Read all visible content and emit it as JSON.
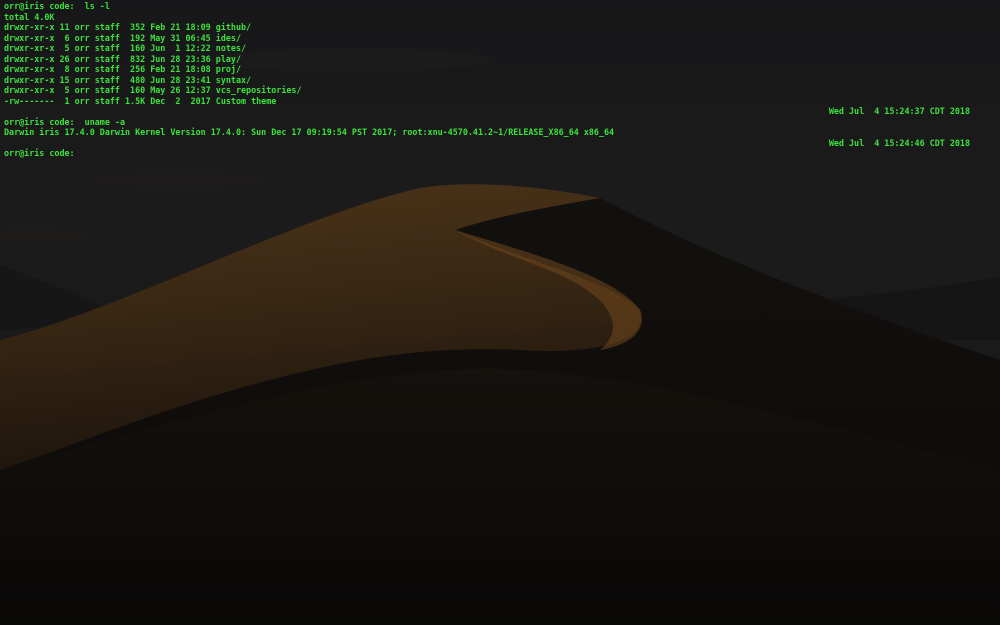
{
  "terminal": {
    "colors": {
      "text": "#3ce23c",
      "background": "#161616",
      "dune_highlight": "#8a5a25"
    },
    "session": [
      {
        "kind": "command",
        "text": "orr@iris code:  ls -l"
      },
      {
        "kind": "output",
        "text": "total 4.0K"
      },
      {
        "kind": "output",
        "text": "drwxr-xr-x 11 orr staff  352 Feb 21 18:09 github/"
      },
      {
        "kind": "output",
        "text": "drwxr-xr-x  6 orr staff  192 May 31 06:45 ides/"
      },
      {
        "kind": "output",
        "text": "drwxr-xr-x  5 orr staff  160 Jun  1 12:22 notes/"
      },
      {
        "kind": "output",
        "text": "drwxr-xr-x 26 orr staff  832 Jun 28 23:36 play/"
      },
      {
        "kind": "output",
        "text": "drwxr-xr-x  8 orr staff  256 Feb 21 18:08 proj/"
      },
      {
        "kind": "output",
        "text": "drwxr-xr-x 15 orr staff  480 Jun 28 23:41 syntax/"
      },
      {
        "kind": "output",
        "text": "drwxr-xr-x  5 orr staff  160 May 26 12:37 vcs_repositories/"
      },
      {
        "kind": "output",
        "text": "-rw-------  1 orr staff 1.5K Dec  2  2017 Custom theme"
      },
      {
        "kind": "rprompt",
        "text": "Wed Jul  4 15:24:37 CDT 2018"
      },
      {
        "kind": "command",
        "text": "orr@iris code:  uname -a"
      },
      {
        "kind": "output",
        "text": "Darwin iris 17.4.0 Darwin Kernel Version 17.4.0: Sun Dec 17 09:19:54 PST 2017; root:xnu-4570.41.2~1/RELEASE_X86_64 x86_64"
      },
      {
        "kind": "rprompt",
        "text": "Wed Jul  4 15:24:46 CDT 2018"
      },
      {
        "kind": "prompt",
        "text": "orr@iris code:"
      }
    ]
  }
}
